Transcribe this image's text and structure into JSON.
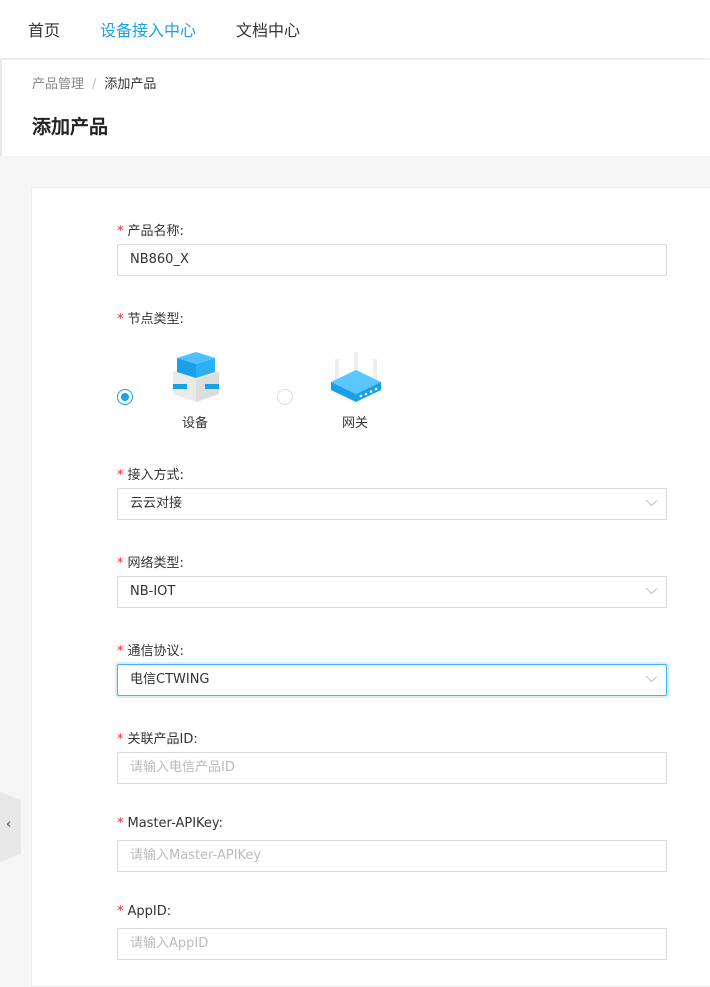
{
  "nav": {
    "items": [
      "首页",
      "设备接入中心",
      "文档中心"
    ],
    "active": 1
  },
  "breadcrumb": {
    "parent": "产品管理",
    "separator": "/",
    "current": "添加产品"
  },
  "page_title": "添加产品",
  "form": {
    "required_mark": "*",
    "product_name": {
      "label": "产品名称:",
      "value": "NB860_X"
    },
    "node_type": {
      "label": "节点类型:",
      "options": [
        "设备",
        "网关"
      ],
      "selected": 0
    },
    "access_method": {
      "label": "接入方式:",
      "value": "云云对接"
    },
    "network_type": {
      "label": "网络类型:",
      "value": "NB-IOT"
    },
    "protocol": {
      "label": "通信协议:",
      "value": "电信CTWING"
    },
    "product_id": {
      "label": "关联产品ID:",
      "placeholder": "请输入电信产品ID"
    },
    "master_apikey": {
      "label": "Master-APIKey:",
      "placeholder": "请输入Master-APIKey"
    },
    "appid": {
      "label": "AppID:",
      "placeholder": "请输入AppID"
    }
  },
  "colors": {
    "accent": "#1aa0e8",
    "required": "#f5222d"
  }
}
